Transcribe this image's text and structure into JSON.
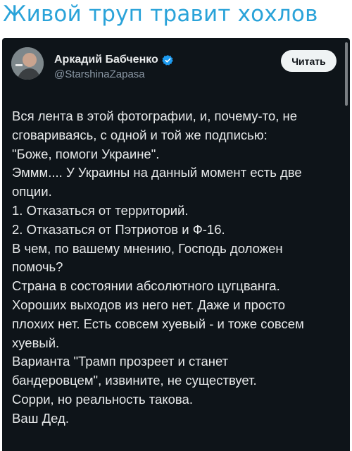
{
  "headline": "Живой труп травит хохлов",
  "tweet": {
    "author_name": "Аркадий Бабченко",
    "handle": "@StarshinaZapasa",
    "follow_label": "Читать",
    "verified_color": "#1d9bf0",
    "lines": [
      "Вся лента в этой фотографии, и, почему-то, не",
      "сговариваясь, с одной и той же подписью:",
      "\"Боже, помоги Украине\".",
      "Эммм.... У Украины на данный момент есть две",
      "опции.",
      "1. Отказаться от территорий.",
      "2. Отказаться от Пэтриотов и Ф-16.",
      "В чем, по вашему мнению, Господь доложен",
      "помочь?",
      "Страна в состоянии абсолютного цугцванга.",
      "Хороших выходов из него нет. Даже и просто",
      "плохих нет. Есть совсем хуевый - и тоже совсем",
      "хуевый.",
      "Варианта \"Трамп прозреет и станет",
      "бандеровцем\", извините, не существует.",
      "Сорри, но реальность такова.",
      "Ваш Дед."
    ]
  }
}
